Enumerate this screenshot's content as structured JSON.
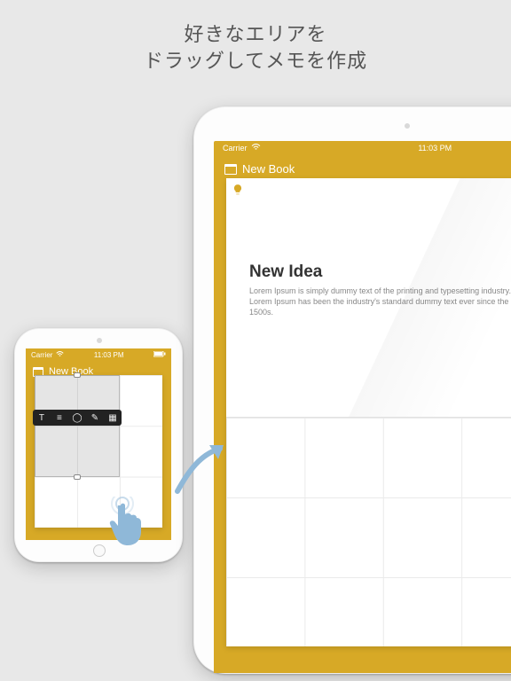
{
  "headline": {
    "line1": "好きなエリアを",
    "line2": "ドラッグしてメモを作成"
  },
  "status": {
    "carrier": "Carrier",
    "time": "11:03 PM",
    "battery": ""
  },
  "book": {
    "title": "New Book"
  },
  "note": {
    "icon": "bulb-icon",
    "title": "New Idea",
    "body": "Lorem Ipsum is simply dummy text of the printing and typesetting industry. Lorem Ipsum has been the industry's standard dummy text ever since the 1500s."
  },
  "toolbar_icons": [
    "T",
    "≡",
    "◯",
    "✎",
    "▦"
  ],
  "colors": {
    "accent": "#d7a926",
    "arrow": "#8fb8d8"
  }
}
